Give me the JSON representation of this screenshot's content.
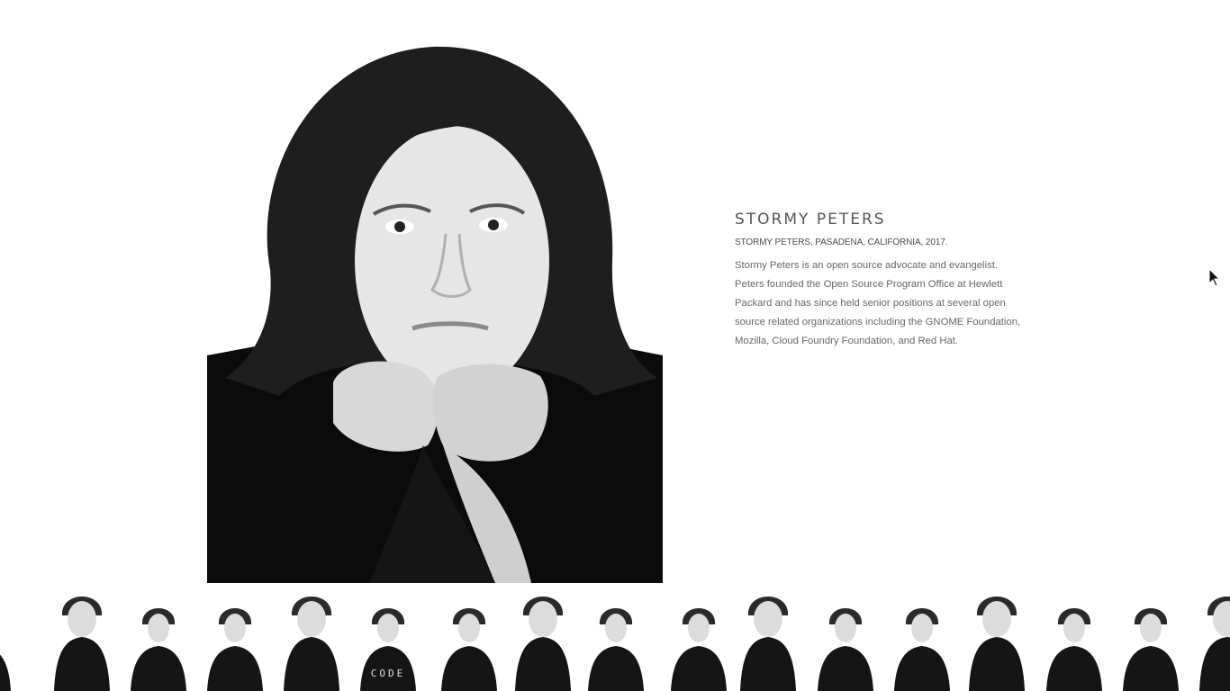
{
  "profile": {
    "name": "STORMY PETERS",
    "caption": "STORMY PETERS, PASADENA, CALIFORNIA, 2017.",
    "bio": "Stormy Peters is an open source advocate and evangelist. Peters founded the Open Source Program Office at Hewlett Packard and has since held senior positions at several open source related organizations including the GNOME Foundation, Mozilla, Cloud Foundry Foundation, and Red Hat."
  },
  "thumbnails": [
    {
      "shirt_text": ""
    },
    {
      "shirt_text": ""
    },
    {
      "shirt_text": ""
    },
    {
      "shirt_text": ""
    },
    {
      "shirt_text": ""
    },
    {
      "shirt_text": "CODE"
    },
    {
      "shirt_text": ""
    },
    {
      "shirt_text": ""
    },
    {
      "shirt_text": ""
    },
    {
      "shirt_text": ""
    },
    {
      "shirt_text": ""
    },
    {
      "shirt_text": ""
    },
    {
      "shirt_text": ""
    },
    {
      "shirt_text": ""
    },
    {
      "shirt_text": ""
    },
    {
      "shirt_text": ""
    },
    {
      "shirt_text": ""
    }
  ],
  "colors": {
    "background": "#ffffff",
    "photo_dark": "#0b0b0b",
    "skin": "#e4e4e4",
    "hair": "#1e1e1e",
    "text": "#555555"
  }
}
